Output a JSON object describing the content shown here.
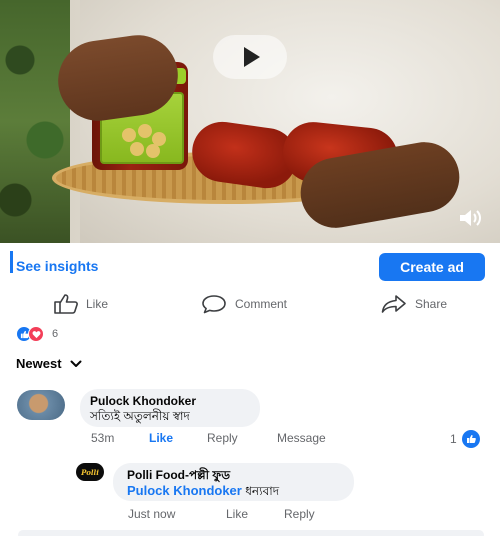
{
  "post": {
    "see_insights": "See insights",
    "create_ad": "Create ad",
    "actions": {
      "like": "Like",
      "comment": "Comment",
      "share": "Share"
    },
    "reaction_count": "6",
    "sort_label": "Newest"
  },
  "comments": [
    {
      "author": "Pulock Khondoker",
      "text": "সত্যিই অতুলনীয় স্বাদ",
      "time": "53m",
      "like_label": "Like",
      "reply_label": "Reply",
      "message_label": "Message",
      "like_count": "1",
      "replies": [
        {
          "author": "Polli Food-পল্লী ফুড",
          "mention": "Pulock Khondoker",
          "text": "ধন্যবাদ",
          "time": "Just now",
          "like_label": "Like",
          "reply_label": "Reply",
          "avatar_text": "Polli"
        }
      ]
    }
  ],
  "colors": {
    "accent": "#1877f2",
    "love": "#f33e58",
    "muted": "#65676b",
    "bubble": "#f0f2f5"
  },
  "icons": [
    "play-icon",
    "volume-icon",
    "like-thumb-icon",
    "comment-bubble-icon",
    "share-arrow-icon",
    "chevron-down-icon"
  ]
}
